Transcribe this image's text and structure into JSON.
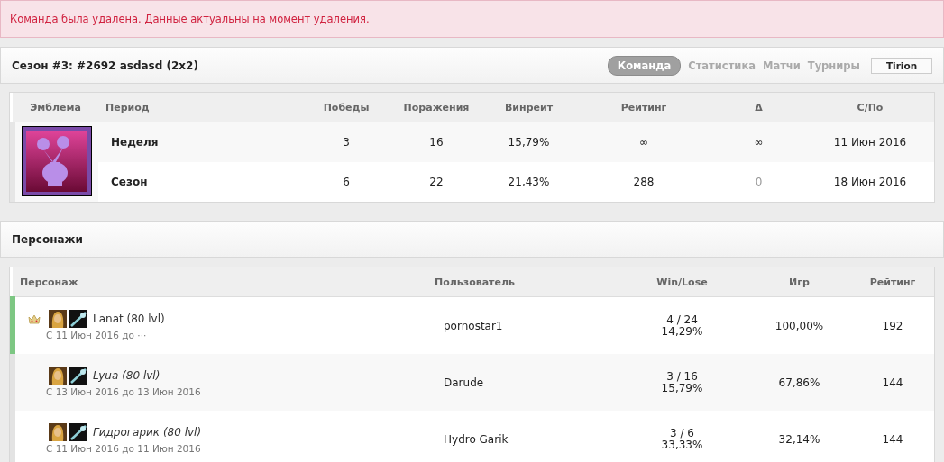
{
  "alert": {
    "text": "Команда была удалена. Данные актуальны на момент удаления."
  },
  "team_header": {
    "title": "Сезон #3: #2692 asdasd (2x2)",
    "tabs": [
      {
        "label": "Команда",
        "selected": true
      },
      {
        "label": "Статистика",
        "selected": false
      },
      {
        "label": "Матчи",
        "selected": false
      },
      {
        "label": "Турниры",
        "selected": false
      }
    ],
    "realm": "Tirion"
  },
  "stats_table": {
    "columns": [
      "Эмблема",
      "Период",
      "Победы",
      "Поражения",
      "Винрейт",
      "Рейтинг",
      "Δ",
      "С/По"
    ],
    "rows": [
      {
        "period": "Неделя",
        "wins": "3",
        "losses": "16",
        "winrate": "15,79%",
        "rating": "∞",
        "delta": "∞",
        "delta_muted": false,
        "date": "11 Июн 2016"
      },
      {
        "period": "Сезон",
        "wins": "6",
        "losses": "22",
        "winrate": "21,43%",
        "rating": "288",
        "delta": "0",
        "delta_muted": true,
        "date": "18 Июн 2016"
      }
    ]
  },
  "members_header": {
    "title": "Персонажи"
  },
  "members_table": {
    "columns": [
      "Персонаж",
      "Пользователь",
      "Win/Lose",
      "Игр",
      "Рейтинг"
    ],
    "rows": [
      {
        "name": "Lanat (80 lvl)",
        "period": "С 11 Июн 2016 до ···",
        "active": true,
        "captain": true,
        "user": "pornostar1",
        "win_lose": "4 / 24",
        "win_pct": "14,29%",
        "games": "100,00%",
        "rating": "192"
      },
      {
        "name": "Lyua (80 lvl)",
        "period": "С 13 Июн 2016 до 13 Июн 2016",
        "active": false,
        "captain": false,
        "user": "Darude",
        "win_lose": "3 / 16",
        "win_pct": "15,79%",
        "games": "67,86%",
        "rating": "144"
      },
      {
        "name": "Гидрогарик (80 lvl)",
        "period": "С 11 Июн 2016 до 11 Июн 2016",
        "active": false,
        "captain": false,
        "user": "Hydro Garik",
        "win_lose": "3 / 6",
        "win_pct": "33,33%",
        "games": "32,14%",
        "rating": "144"
      }
    ]
  }
}
